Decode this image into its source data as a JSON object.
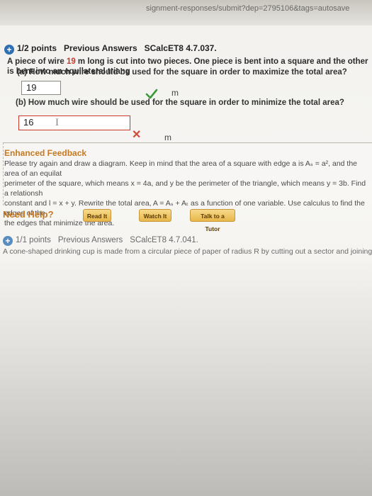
{
  "browser": {
    "url": "signment-responses/submit?dep=2795106&tags=autosave"
  },
  "question1": {
    "points": "1/2 points",
    "previous_answers": "Previous Answers",
    "code": "SCalcET8 4.7.037.",
    "text_before": "A piece of wire ",
    "length_value": "19",
    "text_after": " m long is cut into two pieces. One piece is bent into a square and the other is bent into an equilateral triang",
    "part_a": {
      "label": "(a) How much wire should be used for the square in order to maximize the total area?",
      "answer": "19",
      "unit": "m",
      "status": "correct"
    },
    "part_b": {
      "label": "(b) How much wire should be used for the square in order to minimize the total area?",
      "answer": "16",
      "unit": "m",
      "status": "incorrect"
    },
    "feedback": {
      "title": "Enhanced Feedback",
      "line1": "Please try again and draw a diagram. Keep in mind that the area of a square with edge a is Aₛ = a², and the area of an equilat",
      "line2": "perimeter of the square, which means x = 4a, and y be the perimeter of the triangle, which means y = 3b. Find a relationsh",
      "line3": "constant and l = x + y. Rewrite the total area, A = Aₛ + Aₜ as a function of one variable. Use calculus to find the edges of the",
      "line4": "the edges that minimize the area."
    },
    "help": {
      "label": "Need Help?",
      "read": "Read It",
      "watch": "Watch It",
      "tutor": "Talk to a Tutor"
    }
  },
  "question2": {
    "points": "1/1 points",
    "previous_answers": "Previous Answers",
    "code": "SCalcET8 4.7.041.",
    "text": "A cone-shaped drinking cup is made from a circular piece of paper of radius R by cutting out a sector and joining the edges CA"
  },
  "colors": {
    "accent_blue": "#2f6fb2",
    "highlight_red": "#c43a2a",
    "feedback_orange": "#c8791f",
    "correct_green": "#3a9a3a",
    "incorrect_red": "#d24a3a"
  }
}
